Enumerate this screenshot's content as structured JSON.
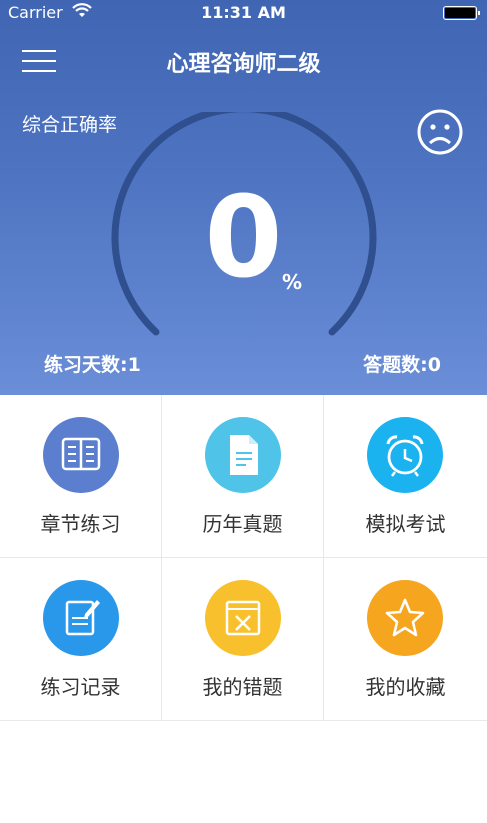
{
  "status_bar": {
    "carrier": "Carrier",
    "time": "11:31 AM"
  },
  "nav": {
    "title": "心理咨询师二级"
  },
  "stats": {
    "accuracy_label": "综合正确率",
    "accuracy_value": "0",
    "accuracy_unit": "%",
    "practice_days": "练习天数:1",
    "answer_count": "答题数:0"
  },
  "grid": [
    {
      "label": "章节练习",
      "icon": "book-icon",
      "color": "#5b7fce"
    },
    {
      "label": "历年真题",
      "icon": "document-icon",
      "color": "#4fc3e8"
    },
    {
      "label": "模拟考试",
      "icon": "alarm-clock-icon",
      "color": "#1ab3f0"
    },
    {
      "label": "练习记录",
      "icon": "edit-note-icon",
      "color": "#2a98ea"
    },
    {
      "label": "我的错题",
      "icon": "wrong-question-icon",
      "color": "#f8c02c"
    },
    {
      "label": "我的收藏",
      "icon": "star-icon",
      "color": "#f5a51e"
    }
  ]
}
